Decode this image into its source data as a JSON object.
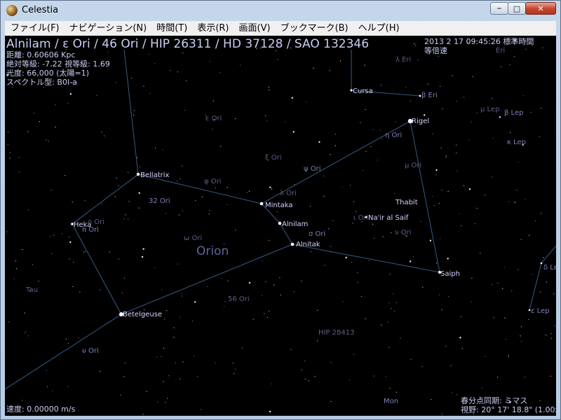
{
  "window": {
    "title": "Celestia"
  },
  "menu": [
    "ファイル(F)",
    "ナビゲーション(N)",
    "時間(T)",
    "表示(R)",
    "画面(V)",
    "ブックマーク(B)",
    "ヘルプ(H)"
  ],
  "hud": {
    "selection": "Alnilam / ε Ori / 46 Ori / HIP 26311 / HD 37128 / SAO 132346",
    "info": [
      "距離: 0.60606 Kpc",
      "絶対等級: -7.22 視等級: 1.69",
      "光度: 66,000 (太陽=1)",
      "スペクトル型: B0I-a"
    ],
    "datetime": "2013 2 17 09:45:26 標準時間",
    "time_rate": "等倍速",
    "speed": "速度: 0.00000 m/s",
    "tracking": "春分点同期: ミマス",
    "fov": "視野: 20° 17' 18.8\" (1.00x)"
  },
  "constellation_name": "Orion",
  "bright_labels": [
    "Bellatrix",
    "Mintaka",
    "Alnilam",
    "Alnitak",
    "Heka",
    "Betelgeuse",
    "Saiph",
    "Rigel",
    "Cursa",
    "Na'ir al Saif",
    "Thabit"
  ],
  "faint_labels": [
    "32 Ori",
    "υ Ori",
    "ο Ori",
    "π Ori",
    "ω Ori",
    "ψ Ori",
    "σ Ori",
    "η Ori",
    "φ Ori",
    "ι Ori",
    "ε Ori",
    "μ Ori",
    "56 Ori",
    "HIP 28413",
    "ξ Ori",
    "λ Ori",
    "ν Ori",
    "β Eri",
    "λ Eri",
    "β Lep",
    "μ Lep",
    "κ Lep",
    "ε Lep",
    "δ Lep",
    "Mon",
    "Tau",
    "Eri"
  ]
}
